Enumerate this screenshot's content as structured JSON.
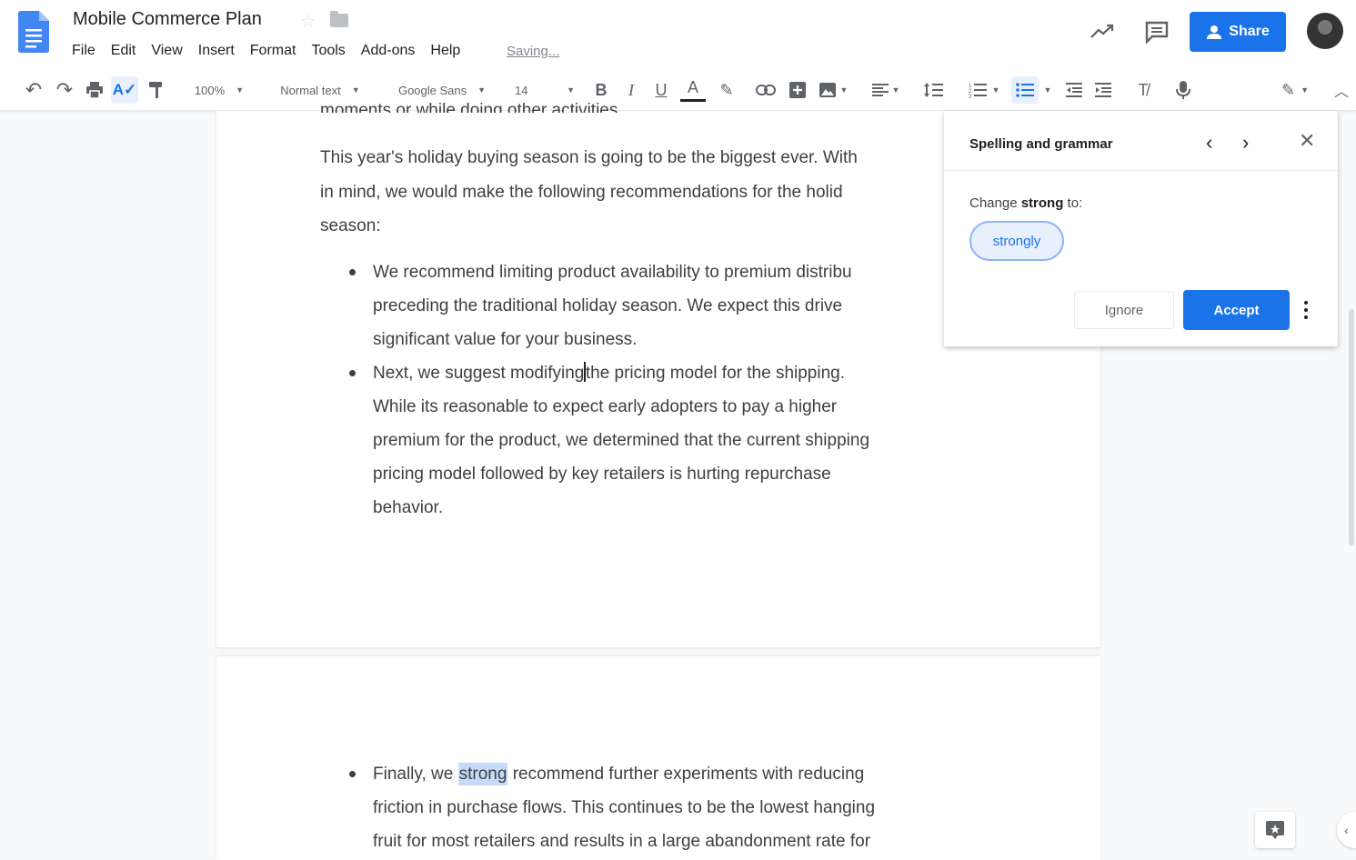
{
  "header": {
    "title": "Mobile Commerce Plan",
    "saving": "Saving...",
    "share_label": "Share",
    "menu": [
      "File",
      "Edit",
      "View",
      "Insert",
      "Format",
      "Tools",
      "Add-ons",
      "Help"
    ]
  },
  "toolbar": {
    "zoom": "100%",
    "style": "Normal text",
    "font": "Google Sans",
    "size": "14"
  },
  "document": {
    "cut_line": "moments or while doing other activities.",
    "intro_lines": [
      "This year's holiday buying season is going to be the biggest ever. With",
      "in mind, we would make the following recommendations for the holid",
      "season:"
    ],
    "bullet1": [
      "We recommend limiting product availability to premium distribu",
      "preceding the traditional holiday season. We expect this drive",
      "significant value for your business."
    ],
    "bullet2_first_before": "Next, we suggest modifying",
    "bullet2_first_after": "the pricing model for the shipping.",
    "bullet2_rest": [
      "While its reasonable to expect early adopters to pay a higher",
      "premium for the product, we determined that the current shipping",
      "pricing model followed by key retailers is hurting repurchase",
      "behavior."
    ],
    "bullet3_before": "Finally, we ",
    "bullet3_highlight": "strong",
    "bullet3_after": " recommend further experiments with reducing",
    "bullet3_rest": [
      "friction in purchase flows. This continues to be the lowest hanging",
      "fruit for most retailers and results in a large abandonment rate for"
    ]
  },
  "spelling": {
    "title": "Spelling and grammar",
    "label_prefix": "Change ",
    "label_word": "strong",
    "label_suffix": " to:",
    "suggestion": "strongly",
    "ignore": "Ignore",
    "accept": "Accept"
  },
  "colors": {
    "accent": "#1a73e8",
    "highlight": "#c6dafc"
  }
}
